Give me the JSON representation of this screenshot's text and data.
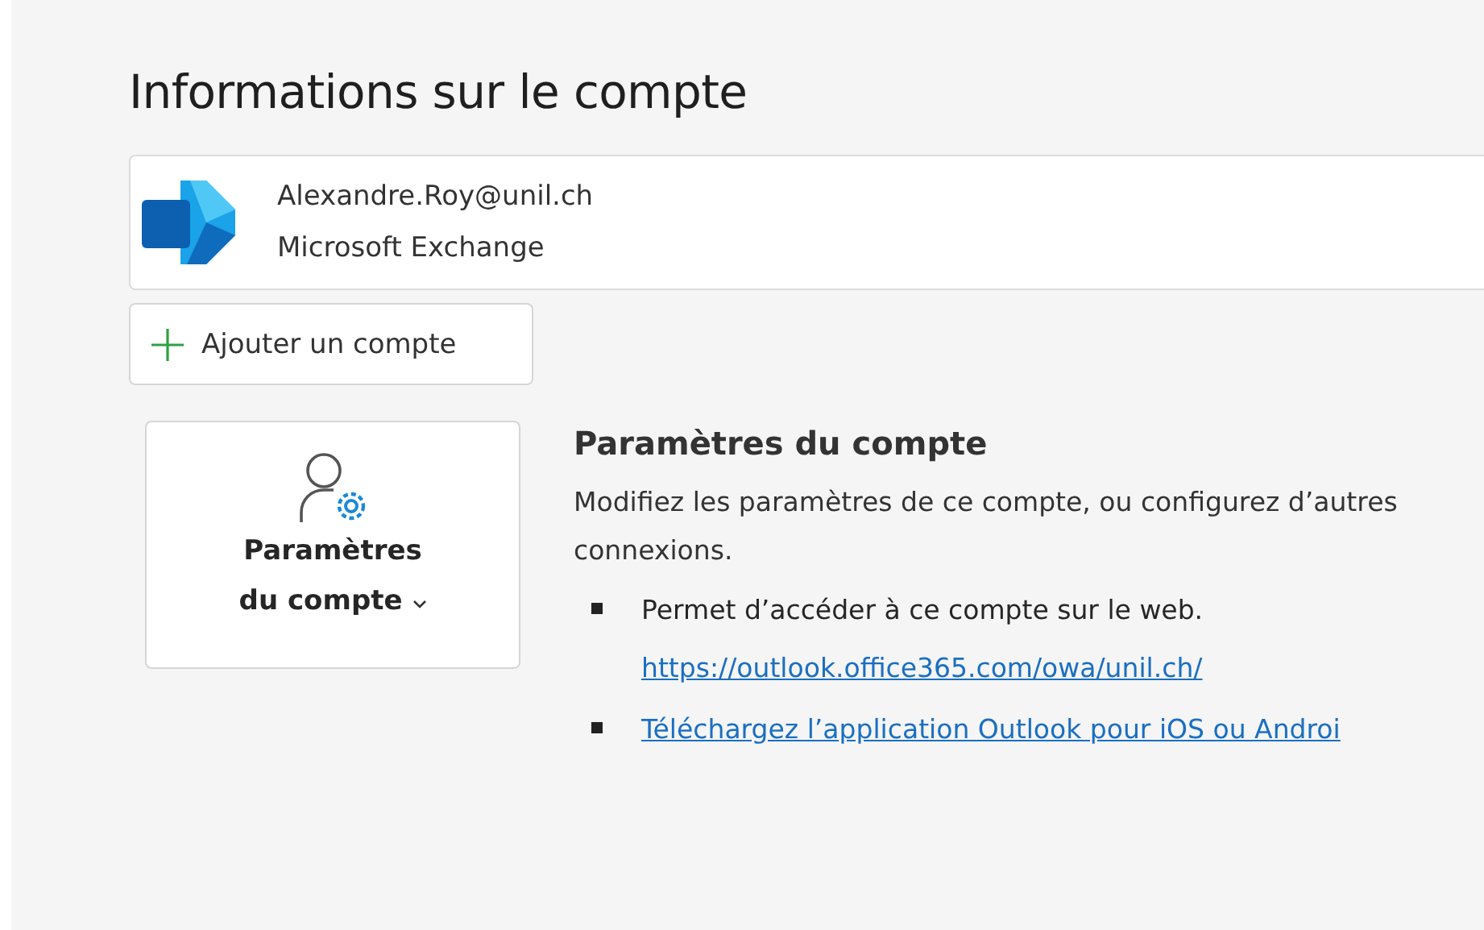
{
  "title": "Informations sur le compte",
  "account": {
    "email": "Alexandre.Roy@unil.ch",
    "type": "Microsoft Exchange"
  },
  "add_account_button": {
    "label": "Ajouter un compte"
  },
  "settings_tile": {
    "label_line_1": "Paramètres",
    "label_line_2": "du compte"
  },
  "settings_section": {
    "heading": "Paramètres du compte",
    "description": "Modifiez les paramètres de ce compte, ou configurez d’autres connexions.",
    "bullets": [
      {
        "kind": "text",
        "text": "Permet d’accéder à ce compte sur le web.",
        "link": "https://outlook.office365.com/owa/unil.ch/"
      },
      {
        "kind": "link",
        "link": "Téléchargez l’application Outlook pour iOS ou Androi"
      }
    ]
  }
}
